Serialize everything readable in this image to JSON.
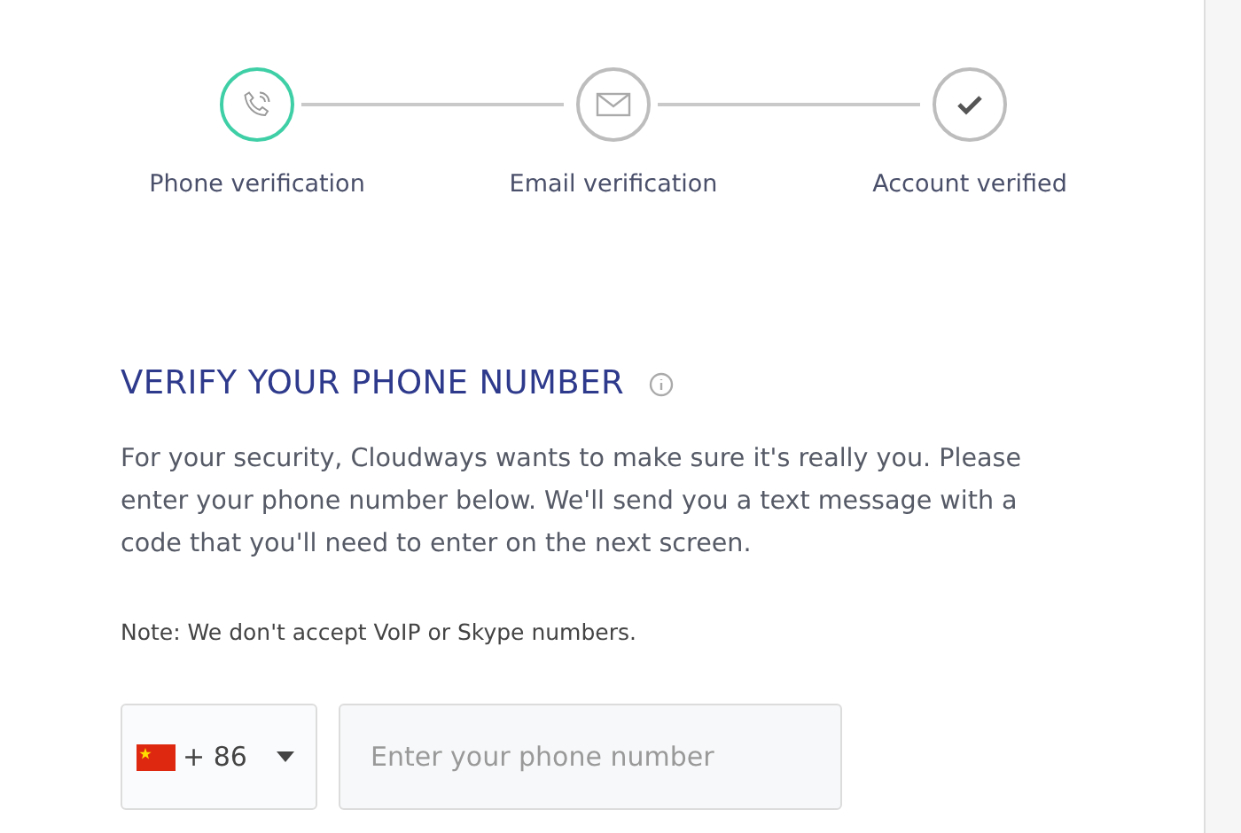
{
  "steps": [
    {
      "kind": "phone",
      "label": "Phone verification",
      "active": true
    },
    {
      "kind": "email",
      "label": "Email verification",
      "active": false
    },
    {
      "kind": "check",
      "label": "Account verified",
      "active": false
    }
  ],
  "heading": "VERIFY YOUR PHONE NUMBER",
  "description": "For your security, Cloudways wants to make sure it's really you. Please enter your phone number below. We'll send you a text message with a code that you'll need to enter on the next screen.",
  "note": "Note: We don't accept VoIP or Skype numbers.",
  "country_code": "+ 86",
  "phone_field": {
    "placeholder": "Enter your phone number"
  }
}
